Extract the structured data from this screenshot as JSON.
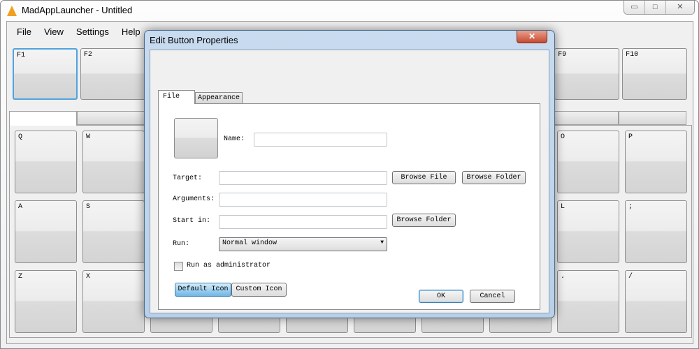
{
  "window": {
    "title": "MadAppLauncher - Untitled",
    "controls": [
      "minimize",
      "maximize",
      "close"
    ]
  },
  "menu": [
    "File",
    "View",
    "Settings",
    "Help"
  ],
  "fkeys": [
    "F1",
    "F2",
    "",
    "",
    "",
    "",
    "",
    "",
    "F9",
    "F10"
  ],
  "rows": [
    [
      "Q",
      "W",
      "",
      "",
      "",
      "",
      "",
      "",
      "O",
      "P"
    ],
    [
      "A",
      "S",
      "",
      "",
      "",
      "",
      "",
      "",
      "L",
      ";"
    ],
    [
      "Z",
      "X",
      "",
      "",
      "",
      "",
      "",
      "",
      ".",
      "/"
    ]
  ],
  "dialog": {
    "title": "Edit Button Properties",
    "tabs": [
      "File",
      "Appearance"
    ],
    "name_label": "Name:",
    "name_value": "",
    "target_label": "Target:",
    "target_value": "",
    "browse_file": "Browse File",
    "browse_folder": "Browse Folder",
    "arguments_label": "Arguments:",
    "arguments_value": "",
    "startin_label": "Start in:",
    "startin_value": "",
    "browse_folder2": "Browse Folder",
    "run_label": "Run:",
    "run_value": "Normal window",
    "admin_label": "Run as administrator",
    "admin_checked": false,
    "default_icon": "Default Icon",
    "custom_icon": "Custom Icon",
    "ok": "OK",
    "cancel": "Cancel"
  }
}
